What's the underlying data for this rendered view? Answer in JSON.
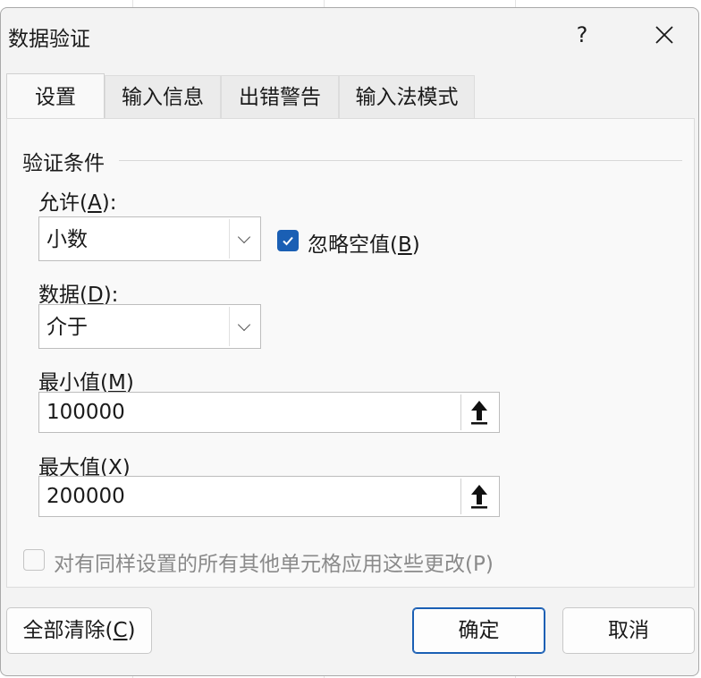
{
  "window": {
    "title": "数据验证",
    "help_label": "?",
    "close_label": "✕"
  },
  "tabs": [
    {
      "label": "设置",
      "active": true
    },
    {
      "label": "输入信息",
      "active": false
    },
    {
      "label": "出错警告",
      "active": false
    },
    {
      "label": "输入法模式",
      "active": false
    }
  ],
  "settings": {
    "group_title": "验证条件",
    "allow": {
      "label_pre": "允许(",
      "accel": "A",
      "label_post": "):",
      "value": "小数"
    },
    "ignore_blank": {
      "label_pre": "忽略空值(",
      "accel": "B",
      "label_post": ")",
      "checked": true
    },
    "data": {
      "label_pre": "数据(",
      "accel": "D",
      "label_post": "):",
      "value": "介于"
    },
    "minimum": {
      "label_pre": "最小值(",
      "accel": "M",
      "label_post": ")",
      "value": "100000"
    },
    "maximum": {
      "label_pre": "最大值(",
      "accel": "X",
      "label_post": ")",
      "value": "200000"
    },
    "apply_all": {
      "label": "对有同样设置的所有其他单元格应用这些更改(P)",
      "checked": false,
      "enabled": false
    }
  },
  "footer": {
    "clear_all_pre": "全部清除(",
    "clear_all_accel": "C",
    "clear_all_post": ")",
    "ok_label": "确定",
    "cancel_label": "取消"
  },
  "colors": {
    "accent": "#1a5fb4",
    "dialog_bg": "#f3f3f3",
    "panel_bg": "#f9f9f9"
  },
  "icons": {
    "dropdown": "chevron-down-icon",
    "range_select": "arrow-up-icon",
    "check": "checkmark-icon"
  }
}
